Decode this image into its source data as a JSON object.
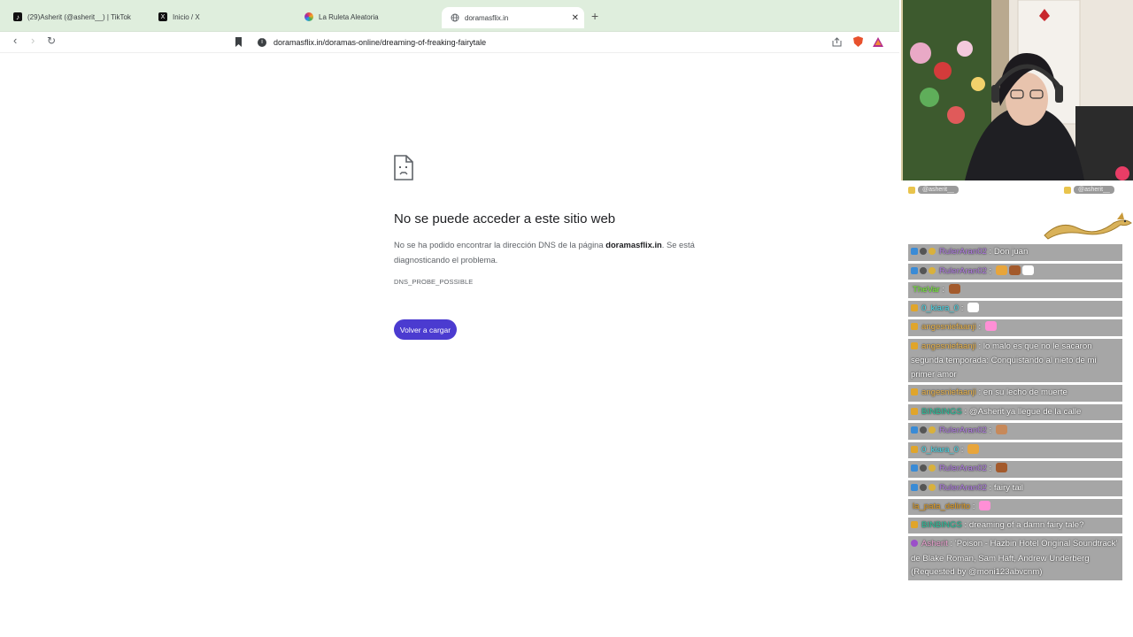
{
  "browser": {
    "tabs": [
      {
        "title": "(29)Asherit (@asherit__) | TikTok",
        "icon": "tiktok-icon",
        "active": false
      },
      {
        "title": "Inicio / X",
        "icon": "x-icon",
        "active": false
      },
      {
        "title": "La Ruleta Aleatoria",
        "icon": "roulette-icon",
        "active": false
      },
      {
        "title": "doramasflix.in",
        "icon": "globe-icon",
        "active": true
      }
    ],
    "url": "doramasflix.in/doramas-online/dreaming-of-freaking-fairytale"
  },
  "error_page": {
    "title": "No se puede acceder a este sitio web",
    "desc_before": "No se ha podido encontrar la dirección DNS de la página ",
    "domain": "doramasflix.in",
    "desc_after": ". Se está diagnosticando el problema.",
    "code": "DNS_PROBE_POSSIBLE",
    "reload_label": "Volver a cargar",
    "accent_color": "#4b3bd0"
  },
  "overlay": {
    "handle_left": "@asherit__",
    "handle_right": "@asherit__"
  },
  "chat": [
    {
      "user": "RulerAran02",
      "color": "#b47ee8",
      "text": "Don juan",
      "badges": [
        "blue",
        "gray",
        "coin"
      ]
    },
    {
      "user": "RulerAran02",
      "color": "#b47ee8",
      "text": "",
      "badges": [
        "blue",
        "gray",
        "coin"
      ],
      "emotes": 3
    },
    {
      "user": "TheVar",
      "color": "#7dff3a",
      "text": "",
      "badges": [],
      "emotes": 1
    },
    {
      "user": "0_kiara_0",
      "color": "#49e0f0",
      "text": "",
      "badges": [
        "crown"
      ],
      "emotes": 1
    },
    {
      "user": "angesniefaanji",
      "color": "#f0b84c",
      "text": "",
      "badges": [
        "crown"
      ],
      "emotes": 1
    },
    {
      "user": "angesniefaanji",
      "color": "#f0b84c",
      "text": "lo malo es que no le sacaron segunda temporada: Conquistando al nieto de mi primer amor",
      "badges": [
        "crown"
      ]
    },
    {
      "user": "angesniefaanji",
      "color": "#f0b84c",
      "text": "en su lecho de muerte",
      "badges": [
        "crown"
      ]
    },
    {
      "user": "BINBINGS",
      "color": "#27c9a1",
      "text": "@Asherit ya llegue de la calle",
      "badges": [
        "crown"
      ]
    },
    {
      "user": "RulerAran02",
      "color": "#b47ee8",
      "text": "",
      "badges": [
        "blue",
        "gray",
        "coin"
      ],
      "emotes": 1
    },
    {
      "user": "0_kiara_0",
      "color": "#49e0f0",
      "text": "",
      "badges": [
        "crown"
      ],
      "emotes": 1
    },
    {
      "user": "RulerAran02",
      "color": "#b47ee8",
      "text": "",
      "badges": [
        "blue",
        "gray",
        "coin"
      ],
      "emotes": 1
    },
    {
      "user": "RulerAran02",
      "color": "#b47ee8",
      "text": "fairy tail",
      "badges": [
        "blue",
        "gray",
        "coin"
      ]
    },
    {
      "user": "la_pata_delirito",
      "color": "#e8a01e",
      "text": "",
      "badges": [],
      "emotes": 1
    },
    {
      "user": "BINBINGS",
      "color": "#27c9a1",
      "text": "dreaming of a damn fairy tale?",
      "badges": [
        "crown"
      ]
    },
    {
      "user": "Asherit",
      "color": "#f2a6d6",
      "text": "'Poison - Hazbin Hotel Original Soundtrack' de Blake Roman, Sam Haft, Andrew Underberg (Requested by @moni123abvcnm)",
      "badges": [
        "purple"
      ]
    }
  ]
}
